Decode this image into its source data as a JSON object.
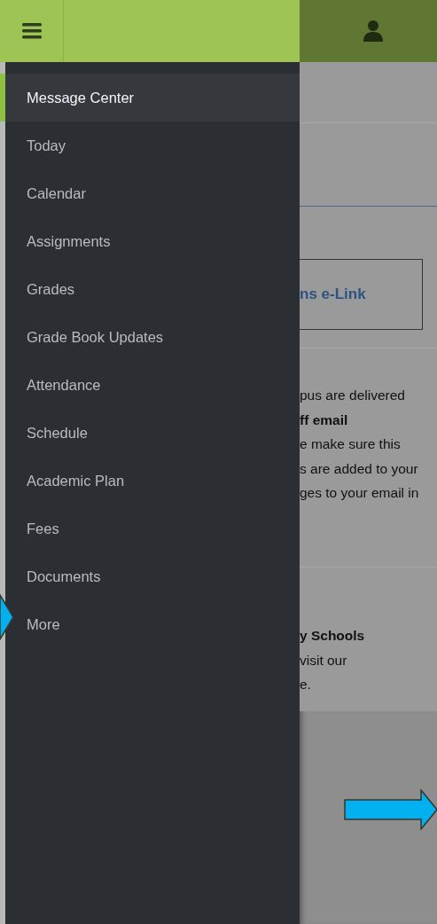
{
  "menu": [
    {
      "label": "Message Center",
      "selected": true
    },
    {
      "label": "Today",
      "selected": false
    },
    {
      "label": "Calendar",
      "selected": false
    },
    {
      "label": "Assignments",
      "selected": false
    },
    {
      "label": "Grades",
      "selected": false
    },
    {
      "label": "Grade Book Updates",
      "selected": false
    },
    {
      "label": "Attendance",
      "selected": false
    },
    {
      "label": "Schedule",
      "selected": false
    },
    {
      "label": "Academic Plan",
      "selected": false
    },
    {
      "label": "Fees",
      "selected": false
    },
    {
      "label": "Documents",
      "selected": false
    },
    {
      "label": "More",
      "selected": false
    }
  ],
  "background": {
    "link_button": "ns e-Link",
    "notice_lines": [
      {
        "text": "pus are delivered",
        "bold": false
      },
      {
        "text": "ff email",
        "bold": true
      },
      {
        "text": "e make sure this",
        "bold": false
      },
      {
        "text": "s are added to your",
        "bold": false
      },
      {
        "text": "ges to your email in",
        "bold": false
      }
    ],
    "info_lines": [
      {
        "text": "y Schools",
        "bold": true
      },
      {
        "text": "visit our",
        "bold": false
      },
      {
        "text": "e.",
        "bold": false
      }
    ]
  }
}
